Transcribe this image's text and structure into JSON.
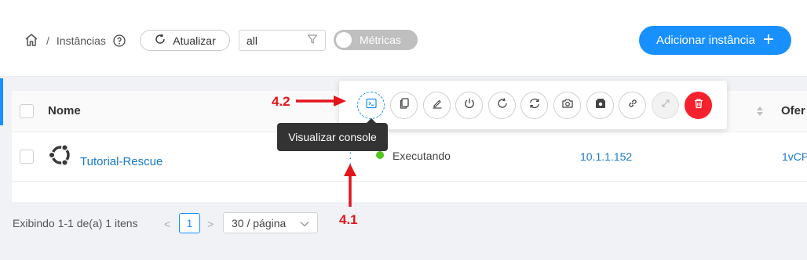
{
  "breadcrumb": {
    "home_icon": "home-icon",
    "separator": "/",
    "current": "Instâncias",
    "help_icon": "question-circle-icon"
  },
  "toolbar": {
    "refresh_label": "Atualizar",
    "filter_value": "all",
    "metrics_label": "Métricas",
    "metrics_enabled": false,
    "add_label": "Adicionar instância"
  },
  "table": {
    "columns": {
      "name": "Nome",
      "offer": "Ofer"
    },
    "rows": [
      {
        "name": "Tutorial-Rescue",
        "os_icon": "ubuntu-icon",
        "status": "Executando",
        "status_color": "#52c41a",
        "ip": "10.1.1.152",
        "offer": "1vCP"
      }
    ]
  },
  "actions": [
    {
      "name": "view-console",
      "icon": "console-icon",
      "active": true
    },
    {
      "name": "copy",
      "icon": "copy-icon"
    },
    {
      "name": "edit",
      "icon": "edit-icon"
    },
    {
      "name": "power",
      "icon": "power-icon"
    },
    {
      "name": "reboot",
      "icon": "reboot-icon"
    },
    {
      "name": "sync",
      "icon": "sync-icon"
    },
    {
      "name": "snapshot",
      "icon": "camera-icon"
    },
    {
      "name": "backup",
      "icon": "backup-icon"
    },
    {
      "name": "link",
      "icon": "link-icon"
    },
    {
      "name": "scale",
      "icon": "expand-icon",
      "disabled": true
    },
    {
      "name": "delete",
      "icon": "delete-icon",
      "danger": true
    }
  ],
  "tooltip": {
    "text": "Visualizar console"
  },
  "annotations": {
    "step_a": "4.2",
    "step_b": "4.1"
  },
  "pagination": {
    "summary": "Exibindo 1-1 de(a) 1 itens",
    "current_page": "1",
    "page_size": "30 / página"
  },
  "colors": {
    "primary": "#1890ff",
    "danger": "#f5222d",
    "annotation": "#e3141c",
    "success": "#52c41a"
  }
}
